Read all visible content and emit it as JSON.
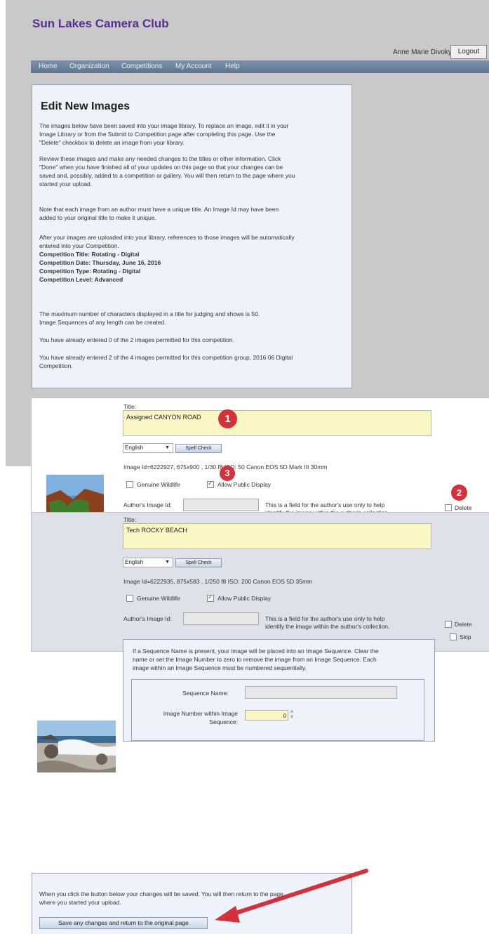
{
  "site": {
    "title": "Sun Lakes Camera Club",
    "user": "Anne Marie Divoky",
    "logout": "Logout"
  },
  "nav": [
    "Home",
    "Organization",
    "Competitions",
    "My Account",
    "Help"
  ],
  "intro": {
    "heading": "Edit New Images",
    "p1": [
      "The images below have been saved into your image library. To replace an image, edit it in your",
      "Image Library or from the Submit to Competition page after completing this page. Use the",
      "\"Delete\" checkbox to delete an image from your library."
    ],
    "p2": [
      "Review these images and make any needed changes to the titles or other information. Click",
      "\"Done\" when you have finished all of your updates on this page so that your changes can be",
      "saved and, possibly, added to a competition or gallery. You will then return to the page where you",
      "started your upload."
    ],
    "p3": [
      "Note that each image from an author must have a unique title. An Image Id may have been",
      "added to your original title to make it unique."
    ],
    "p4": [
      "After your images are uploaded into your library, references to those images will be automatically",
      "entered into your Competition."
    ],
    "comp": [
      "Competition Title: Rotating - Digital",
      "Competition Date: Thursday, June 16, 2016",
      "Competition Type: Rotating - Digital",
      "Competition Level: Advanced"
    ],
    "p5": [
      "The maximum number of characters displayed in a title for judging and shows is 50.",
      "Image Sequences of any length can be created."
    ],
    "p6": "You have already entered 0 of the 2 images permitted for this competition.",
    "p7": [
      "You have already entered 2 of the 4 images permitted for this competition group, 2016 06 Digital",
      "Competition."
    ]
  },
  "labels": {
    "title": "Title:",
    "language": "English",
    "spell": "Spell Check",
    "wildlife": "Genuine Wildlife",
    "public": "Allow Public Display",
    "author_id": "Author's Image Id:",
    "author_help": [
      "This is a field for the author's use only to help",
      "identify the image within the author's collection."
    ],
    "delete": "Delete",
    "skip": "Skip",
    "seq_help": [
      "If a Sequence Name is present, your image will be placed into an Image Sequence. Clear the",
      "name or set the Image Number to zero to remove the image from an Image Sequence. Each",
      "image within an Image Sequence must be numbered sequentially."
    ],
    "seq_name": "Sequence Name:",
    "img_num": [
      "Image Number within Image",
      "Sequence:"
    ]
  },
  "images": [
    {
      "title": "Assigned CANYON ROAD",
      "info": "Image Id=6222927, 675x900 , 1/30 f8 ISO: 50 Canon EOS 5D Mark III 30mm",
      "wildlife": false,
      "public": true,
      "number": "0"
    },
    {
      "title": "Tech ROCKY BEACH",
      "info": "Image Id=6222935, 875x583 , 1/250 f8 ISO: 200 Canon EOS 5D 35mm",
      "wildlife": false,
      "public": true,
      "number": "0"
    }
  ],
  "footer": {
    "text": [
      "When you click the button below your changes will be saved. You will then return to the page",
      "where you started your upload."
    ],
    "button": "Save any changes and return to the original page"
  },
  "annotations": [
    "1",
    "2",
    "3"
  ],
  "colors": {
    "accent": "#5a2d91",
    "annotation": "#d3323a",
    "title_field": "#fbf7c5"
  }
}
